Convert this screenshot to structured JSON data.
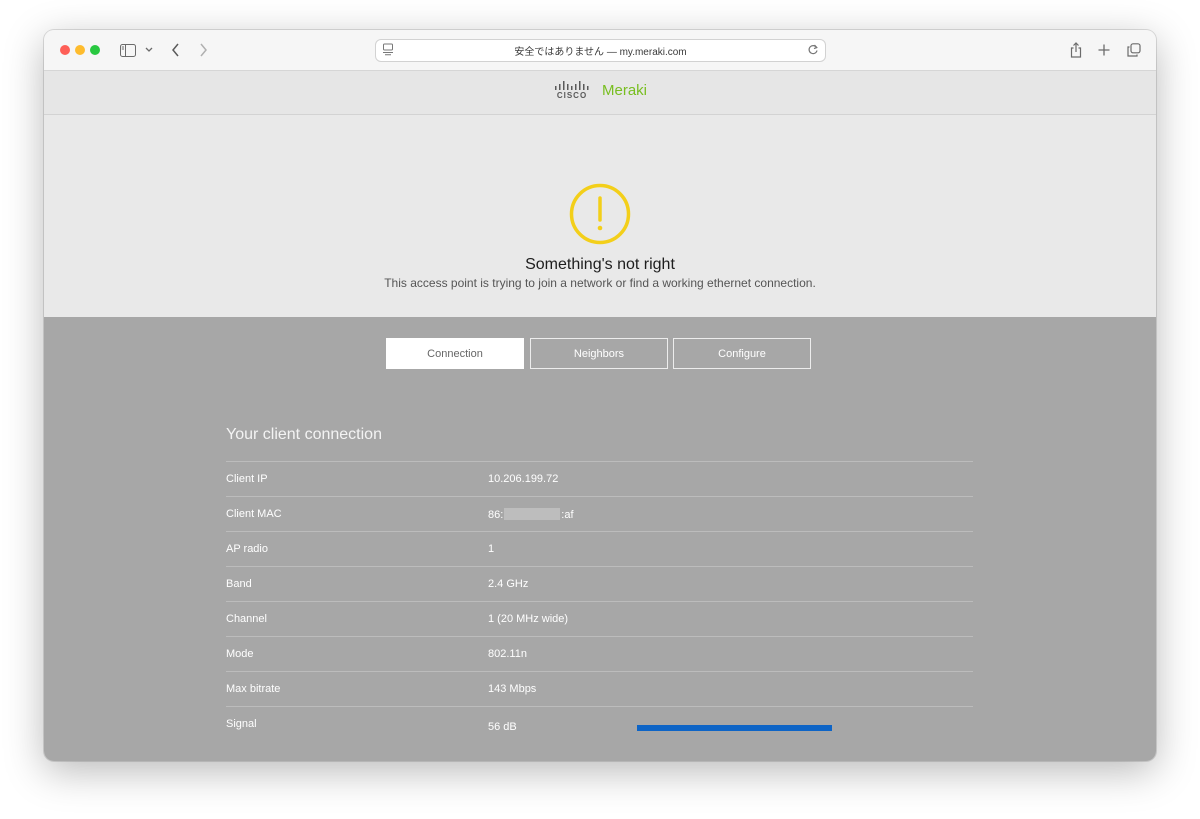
{
  "browser": {
    "address": "安全ではありません — my.meraki.com"
  },
  "brand": {
    "cisco": "CISCO",
    "meraki": "Meraki"
  },
  "hero": {
    "title": "Something's not right",
    "subtitle": "This access point is trying to join a network or find a working ethernet connection."
  },
  "tabs": [
    {
      "label": "Connection",
      "active": true
    },
    {
      "label": "Neighbors",
      "active": false
    },
    {
      "label": "Configure",
      "active": false
    }
  ],
  "connection": {
    "title": "Your client connection",
    "rows": [
      {
        "label": "Client IP",
        "value": "10.206.199.72"
      },
      {
        "label": "Client MAC",
        "value_prefix": "86:",
        "value_suffix": ":af"
      },
      {
        "label": "AP radio",
        "value": "1"
      },
      {
        "label": "Band",
        "value": "2.4 GHz"
      },
      {
        "label": "Channel",
        "value": "1 (20 MHz wide)"
      },
      {
        "label": "Mode",
        "value": "802.11n"
      },
      {
        "label": "Max bitrate",
        "value": "143 Mbps"
      },
      {
        "label": "Signal",
        "value": "56 dB"
      }
    ]
  },
  "colors": {
    "warning": "#f3cf1a",
    "meraki_green": "#78be20",
    "signal_bar": "#0d64c6"
  },
  "icons": [
    "sidebar-icon",
    "chevron-down-icon",
    "back-icon",
    "forward-icon",
    "page-icon",
    "reload-icon",
    "share-icon",
    "plus-icon",
    "tabs-icon",
    "warning-icon"
  ]
}
